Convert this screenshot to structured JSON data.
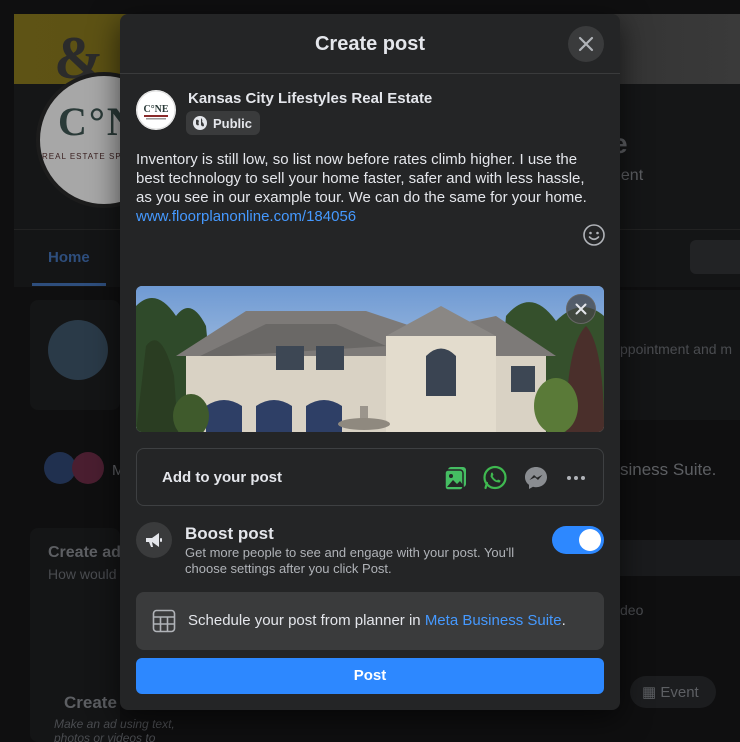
{
  "background": {
    "page_title_partial": "e",
    "page_subtitle_partial": "gent",
    "nav_home": "Home",
    "ad_card_title_partial": "Create ad",
    "ad_card_sub_partial": "How would",
    "ad_create_partial": "Create",
    "ad_make_partial": "Make an ad using text, photos or videos to",
    "social_m_partial": "M",
    "appointment_partial": "ppointment and m",
    "suite_partial": "siness Suite.",
    "video_partial": "deo",
    "event_label": "Event"
  },
  "modal": {
    "title": "Create post",
    "author": {
      "name": "Kansas City Lifestyles Real Estate",
      "audience": "Public",
      "avatar_text": "C°NE"
    },
    "post_text": "Inventory is still low, so list now before rates climb higher.  I use the best technology to sell your home faster, safer and with less hassle, as you see in our example tour.  We can do the same for your home.",
    "post_link": "www.floorplanonline.com/184056",
    "add_to_post": {
      "label": "Add to your post",
      "icons": [
        "photo-video-icon",
        "whatsapp-icon",
        "messenger-icon",
        "more-icon"
      ]
    },
    "boost": {
      "title": "Boost post",
      "description": "Get more people to see and engage with your post. You'll choose settings after you click Post.",
      "enabled": true
    },
    "schedule": {
      "text": "Schedule your post from planner in ",
      "link": "Meta Business Suite",
      "suffix": "."
    },
    "post_button": "Post"
  },
  "colors": {
    "modal_bg": "#242526",
    "accent": "#2d88ff",
    "link": "#4599ff",
    "whatsapp": "#3fb950",
    "photo": "#45bd62"
  }
}
